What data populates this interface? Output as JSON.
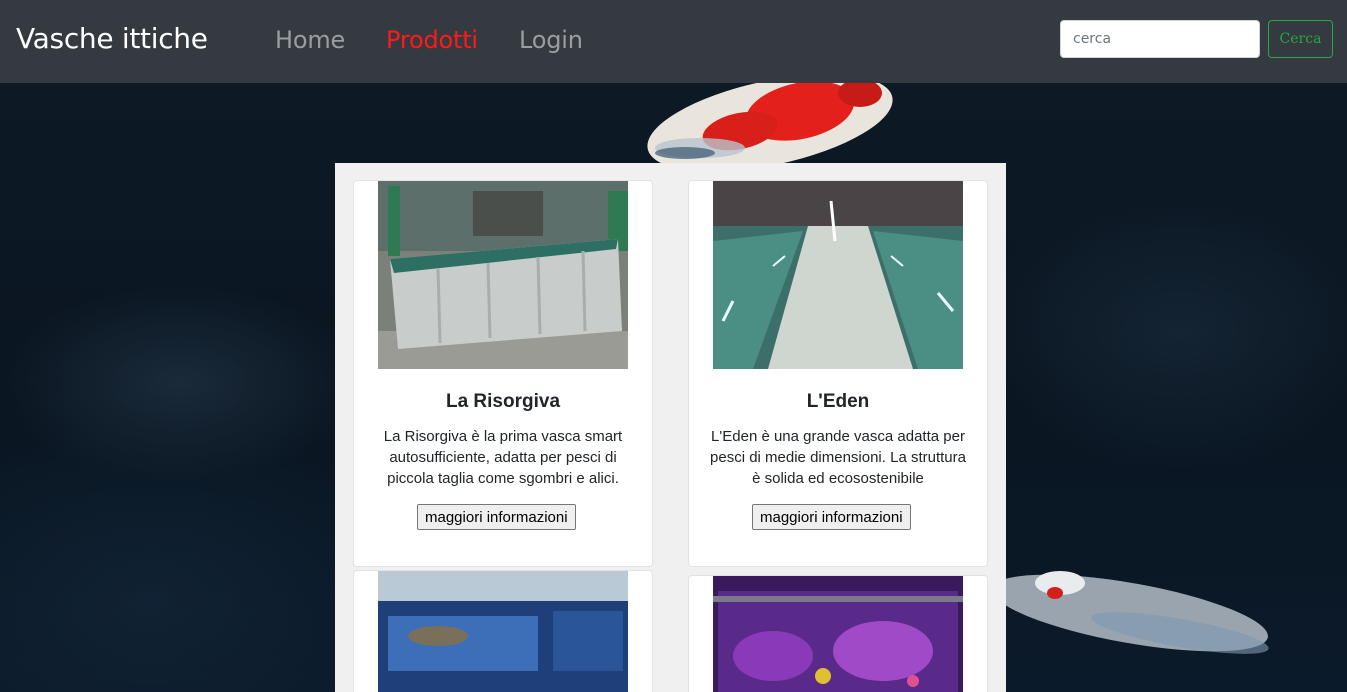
{
  "navbar": {
    "brand": "Vasche ittiche",
    "links": [
      {
        "label": "Home",
        "active": false
      },
      {
        "label": "Prodotti",
        "active": true
      },
      {
        "label": "Login",
        "active": false
      }
    ],
    "search": {
      "placeholder": "cerca",
      "value": "",
      "button_label": "Cerca"
    }
  },
  "products": [
    {
      "title": "La Risorgiva",
      "description": "La Risorgiva è la prima vasca smart autosufficiente, adatta per pesci di piccola taglia come sgombri e alici.",
      "button_label": "maggiori informazioni"
    },
    {
      "title": "L'Eden",
      "description": "L'Eden è una grande vasca adatta per pesci di medie dimensioni. La struttura è solida ed ecosostenibile",
      "button_label": "maggiori informazioni"
    },
    {
      "title": "",
      "description": "",
      "button_label": ""
    },
    {
      "title": "",
      "description": "",
      "button_label": ""
    }
  ],
  "colors": {
    "navbar_bg": "#343a40",
    "active_link": "#ff1a1a",
    "search_button": "#28a745",
    "panel_bg": "#f0f0f0"
  }
}
